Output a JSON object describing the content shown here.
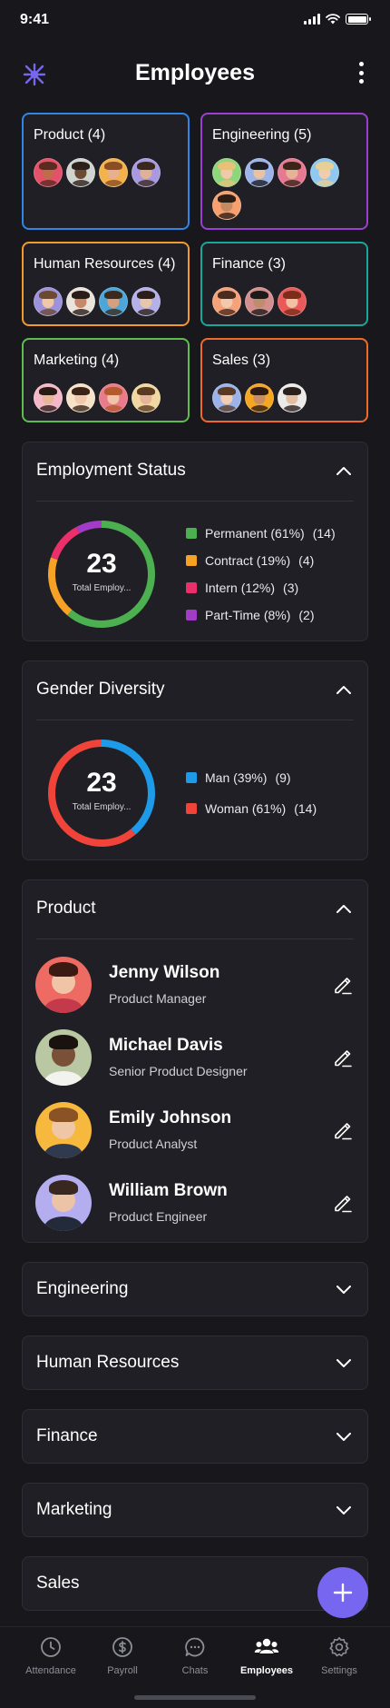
{
  "status_bar": {
    "time": "9:41"
  },
  "header": {
    "title": "Employees"
  },
  "departments": [
    {
      "label": "Product (4)",
      "color": "#2f86e6",
      "avatars": [
        [
          "#e3516a",
          "#5a2b1f",
          "#c26a4b"
        ],
        [
          "#cfd4cf",
          "#2d1f1a",
          "#6b4a34"
        ],
        [
          "#f3b24c",
          "#8a4d24",
          "#e7b090"
        ],
        [
          "#a89ae0",
          "#3a281e",
          "#e0b196"
        ]
      ]
    },
    {
      "label": "Engineering (5)",
      "color": "#9b3fd0",
      "avatars": [
        [
          "#8ed67c",
          "#e8c07a",
          "#f0c9a9"
        ],
        [
          "#9cb4e8",
          "#1c1c22",
          "#e8c2a3"
        ],
        [
          "#e57a92",
          "#3b2418",
          "#e7b397"
        ],
        [
          "#8fc8f0",
          "#e8cf95",
          "#f1cdb0"
        ],
        [
          "#f5a06e",
          "#2c1d15",
          "#c58a62"
        ]
      ]
    },
    {
      "label": "Human Resources (4)",
      "color": "#f39a2c",
      "avatars": [
        [
          "#9d93da",
          "#6b4a30",
          "#f0c8a8"
        ],
        [
          "#e9e3dc",
          "#2a1c16",
          "#c7886a"
        ],
        [
          "#4da6d8",
          "#3d2a1f",
          "#d6a07e"
        ],
        [
          "#b4b0e8",
          "#2a1e18",
          "#e9c6aa"
        ]
      ]
    },
    {
      "label": "Finance (3)",
      "color": "#17a79b",
      "avatars": [
        [
          "#f4a27a",
          "#4a2c1f",
          "#f2c9ad"
        ],
        [
          "#d38e8e",
          "#1e1a1a",
          "#c08d6c"
        ],
        [
          "#ea5a5a",
          "#7a2e1a",
          "#f0c1a2"
        ]
      ]
    },
    {
      "label": "Marketing (4)",
      "color": "#5fbd4f",
      "avatars": [
        [
          "#f4b8c8",
          "#2a1a14",
          "#e8b79a"
        ],
        [
          "#f6e2c9",
          "#3a2418",
          "#f0c9ad"
        ],
        [
          "#ea7b8a",
          "#b35a2e",
          "#f1c4a8"
        ],
        [
          "#f1d8a0",
          "#5a3a20",
          "#e6b597"
        ]
      ]
    },
    {
      "label": "Sales (3)",
      "color": "#ef6a2a",
      "avatars": [
        [
          "#9cb3ea",
          "#5a3a24",
          "#f2cdb0"
        ],
        [
          "#f5a623",
          "#2d1c14",
          "#c98c63"
        ],
        [
          "#ecebe9",
          "#2a211c",
          "#e3bfa4"
        ]
      ]
    }
  ],
  "employment_status": {
    "title": "Employment Status",
    "total": "23",
    "total_label": "Total Employ...",
    "items": [
      {
        "label": "Permanent (61%)",
        "count": "(14)",
        "color": "#4caf50",
        "pct": 61
      },
      {
        "label": "Contract (19%)",
        "count": "(4)",
        "color": "#f7a125",
        "pct": 19
      },
      {
        "label": "Intern (12%)",
        "count": "(3)",
        "color": "#ea2f6a",
        "pct": 12
      },
      {
        "label": "Part-Time (8%)",
        "count": "(2)",
        "color": "#a23bc6",
        "pct": 8
      }
    ]
  },
  "gender_diversity": {
    "title": "Gender Diversity",
    "total": "23",
    "total_label": "Total Employ...",
    "items": [
      {
        "label": "Man (39%)",
        "count": "(9)",
        "color": "#1e9be8",
        "pct": 39
      },
      {
        "label": "Woman (61%)",
        "count": "(14)",
        "color": "#f0443a",
        "pct": 61
      }
    ]
  },
  "product_section": {
    "title": "Product",
    "employees": [
      {
        "name": "Jenny Wilson",
        "role": "Product Manager",
        "bg": "#ee6b63",
        "hair": "#3a1a12",
        "skin": "#f0c4a6",
        "shirt": "#c43a4a"
      },
      {
        "name": "Michael Davis",
        "role": "Senior Product Designer",
        "bg": "#b9c7a3",
        "hair": "#1a120e",
        "skin": "#7a5038",
        "shirt": "#f2f2ef"
      },
      {
        "name": "Emily Johnson",
        "role": "Product Analyst",
        "bg": "#f6b83d",
        "hair": "#8a5326",
        "skin": "#efc7a7",
        "shirt": "#2f3a4e"
      },
      {
        "name": "William Brown",
        "role": "Product Engineer",
        "bg": "#b4aef0",
        "hair": "#3a2820",
        "skin": "#ecc3a5",
        "shirt": "#232a3a"
      }
    ]
  },
  "collapsed_sections": [
    "Engineering",
    "Human Resources",
    "Finance",
    "Marketing",
    "Sales"
  ],
  "tabbar": {
    "tabs": [
      {
        "label": "Attendance",
        "icon": "clock-icon"
      },
      {
        "label": "Payroll",
        "icon": "dollar-icon"
      },
      {
        "label": "Chats",
        "icon": "chat-icon"
      },
      {
        "label": "Employees",
        "icon": "people-icon",
        "active": true
      },
      {
        "label": "Settings",
        "icon": "gear-icon"
      }
    ]
  },
  "accent": "#7766ef"
}
